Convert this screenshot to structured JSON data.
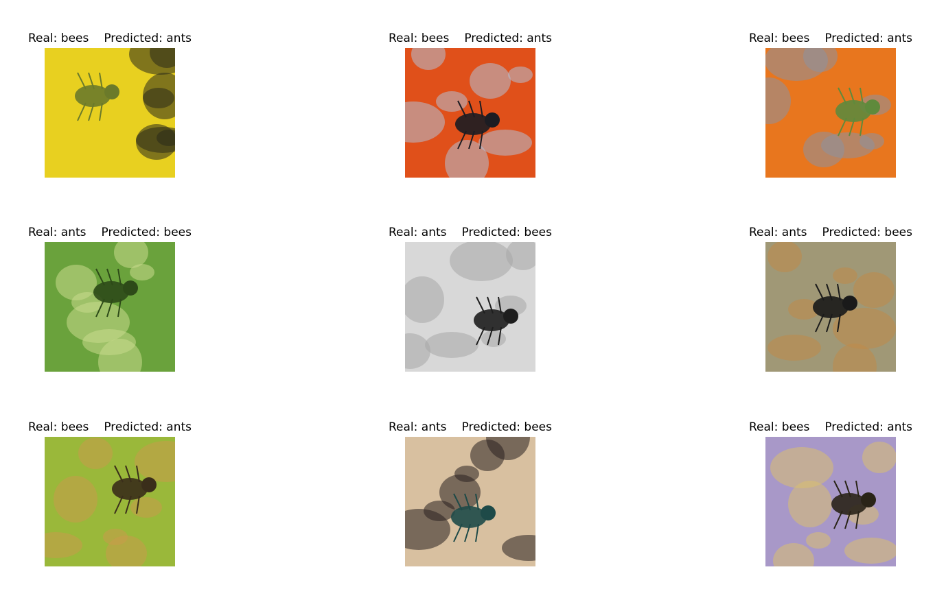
{
  "figure": {
    "cells": [
      {
        "real": "Real: bees",
        "predicted": "Predicted: ants",
        "image": "yellow-flowers-with-bee",
        "palette": [
          "#e8d020",
          "#6b7a2a",
          "#2a2a1a"
        ]
      },
      {
        "real": "Real: bees",
        "predicted": "Predicted: ants",
        "image": "bumblebees-on-coneflower",
        "palette": [
          "#e0501a",
          "#1c1c22",
          "#b4c0d4"
        ]
      },
      {
        "real": "Real: bees",
        "predicted": "Predicted: ants",
        "image": "bee-on-orange-flower",
        "palette": [
          "#e8761e",
          "#5f8a3c",
          "#8c92a0"
        ]
      },
      {
        "real": "Real: ants",
        "predicted": "Predicted: bees",
        "image": "ant-on-green-stem",
        "palette": [
          "#6aa23c",
          "#2d4a18",
          "#c8da8c"
        ]
      },
      {
        "real": "Real: ants",
        "predicted": "Predicted: bees",
        "image": "ant-on-gray-surface",
        "palette": [
          "#d8d8d8",
          "#1e1e1e",
          "#a8a8a8"
        ]
      },
      {
        "real": "Real: ants",
        "predicted": "Predicted: bees",
        "image": "spider-on-leaf",
        "palette": [
          "#a09876",
          "#1a1a1a",
          "#c08a48"
        ]
      },
      {
        "real": "Real: bees",
        "predicted": "Predicted: ants",
        "image": "bee-on-green-leaf",
        "palette": [
          "#9ab83a",
          "#3a2e1a",
          "#c89a4a"
        ]
      },
      {
        "real": "Real: ants",
        "predicted": "Predicted: bees",
        "image": "green-ant-on-leaf",
        "palette": [
          "#d8c0a0",
          "#1e4a48",
          "#2a2020"
        ]
      },
      {
        "real": "Real: bees",
        "predicted": "Predicted: ants",
        "image": "bee-on-purple-flowers",
        "palette": [
          "#a898c8",
          "#2a2418",
          "#d8c070"
        ]
      }
    ]
  }
}
